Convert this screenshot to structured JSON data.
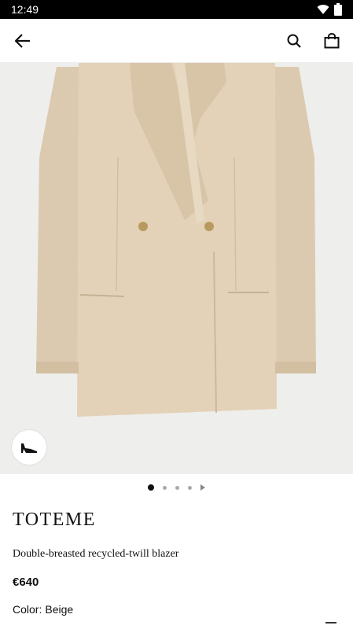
{
  "status_bar": {
    "time": "12:49"
  },
  "app_bar": {
    "back_icon": "arrow-left-icon",
    "search_icon": "search-icon",
    "bag_icon": "shopping-bag-icon"
  },
  "gallery": {
    "image_label": "beige double-breasted blazer",
    "shoe_badge_icon": "high-heel-icon",
    "page_count": 4,
    "active_page": 1
  },
  "product": {
    "brand": "TOTEME",
    "name": "Double-breasted recycled-twill blazer",
    "price": "€640",
    "color_label": "Color:",
    "color_value": "Beige"
  },
  "colors": {
    "blazer": "#e3d2b8",
    "blazer_shadow": "#cdb89a",
    "background": "#eeeeec"
  }
}
